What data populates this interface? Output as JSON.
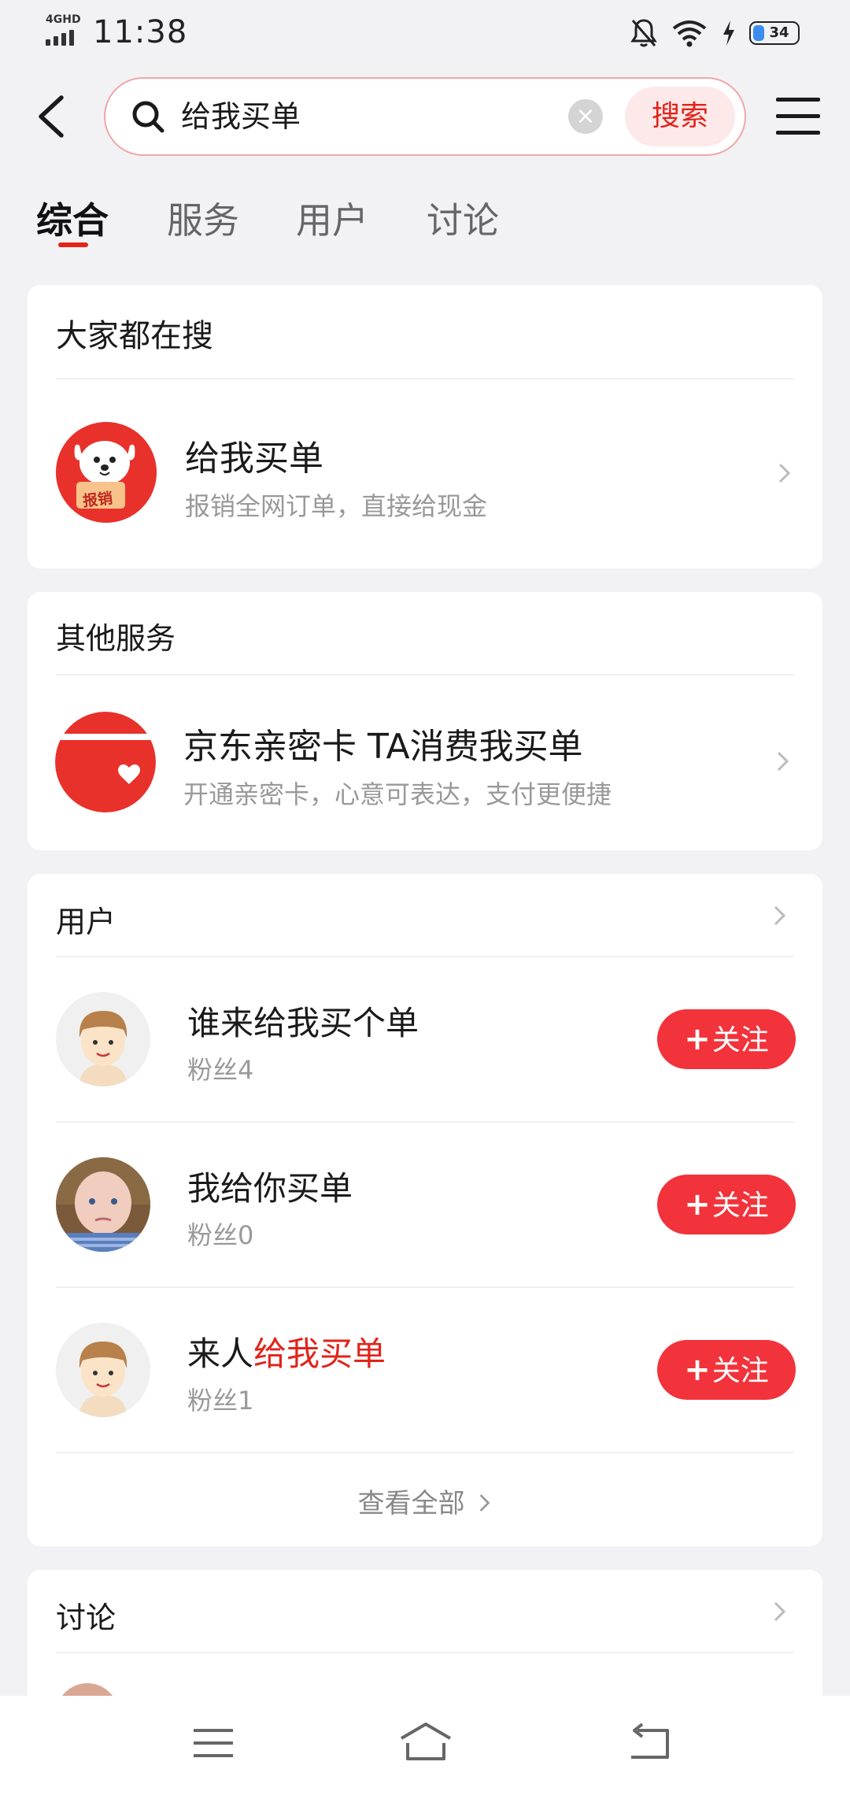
{
  "status_bar": {
    "network": "4GHD",
    "time": "11:38",
    "battery": "34"
  },
  "search": {
    "query": "给我买单",
    "button_label": "搜索"
  },
  "tabs": [
    {
      "label": "综合",
      "active": true
    },
    {
      "label": "服务",
      "active": false
    },
    {
      "label": "用户",
      "active": false
    },
    {
      "label": "讨论",
      "active": false
    }
  ],
  "popular": {
    "title": "大家都在搜",
    "item": {
      "name": "给我买单",
      "desc": "报销全网订单，直接给现金",
      "badge": "报销"
    }
  },
  "other_services": {
    "title": "其他服务",
    "item": {
      "name": "京东亲密卡 TA消费我买单",
      "desc": "开通亲密卡，心意可表达，支付更便捷"
    }
  },
  "users": {
    "title": "用户",
    "follow_label": "关注",
    "follow_plus": "+",
    "items": [
      {
        "name": "谁来给我买个单",
        "name_prefix": "",
        "name_highlight": "",
        "fans": "粉丝4"
      },
      {
        "name": "我给你买单",
        "name_prefix": "",
        "name_highlight": "",
        "fans": "粉丝0"
      },
      {
        "name": "",
        "name_prefix": "来人",
        "name_highlight": "给我买单",
        "fans": "粉丝1"
      }
    ],
    "view_all": "查看全部"
  },
  "discussion": {
    "title": "讨论"
  },
  "colors": {
    "accent": "#e2231a",
    "follow_button": "#f2333b",
    "background": "#f2f2f5"
  }
}
